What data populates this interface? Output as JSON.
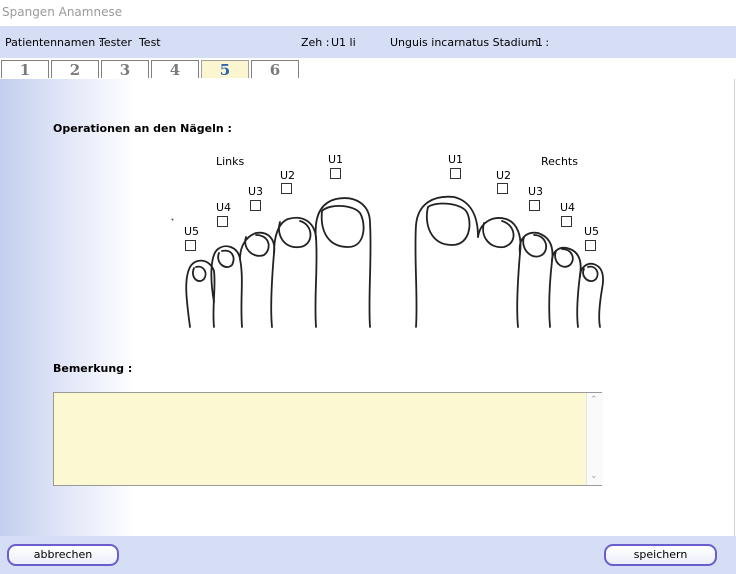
{
  "window": {
    "title": "Spangen Anamnese"
  },
  "info": {
    "patient_label": "Patientennamen :",
    "patient_value": "Tester  Test",
    "toe_label": "Zeh :",
    "toe_value": "U1 li",
    "stage_label": "Unguis incarnatus Stadium  :",
    "stage_value": "1"
  },
  "tabs": [
    {
      "label": "1"
    },
    {
      "label": "2"
    },
    {
      "label": "3"
    },
    {
      "label": "4"
    },
    {
      "label": "5",
      "active": true
    },
    {
      "label": "6"
    }
  ],
  "main": {
    "operations_heading": "Operationen an den Nägeln :",
    "left_label": "Links",
    "right_label": "Rechts",
    "left_toes": [
      "U1",
      "U2",
      "U3",
      "U4",
      "U5"
    ],
    "right_toes": [
      "U1",
      "U2",
      "U3",
      "U4",
      "U5"
    ],
    "remark_heading": "Bemerkung :",
    "remark_value": ""
  },
  "buttons": {
    "cancel": "abbrechen",
    "save": "speichern"
  },
  "colors": {
    "info_bar": "#d6def6",
    "active_tab_bg": "#fbf6cf",
    "active_tab_text": "#2a64b5",
    "textarea_bg": "#fbf8d2",
    "button_border": "#6a5ecf"
  }
}
